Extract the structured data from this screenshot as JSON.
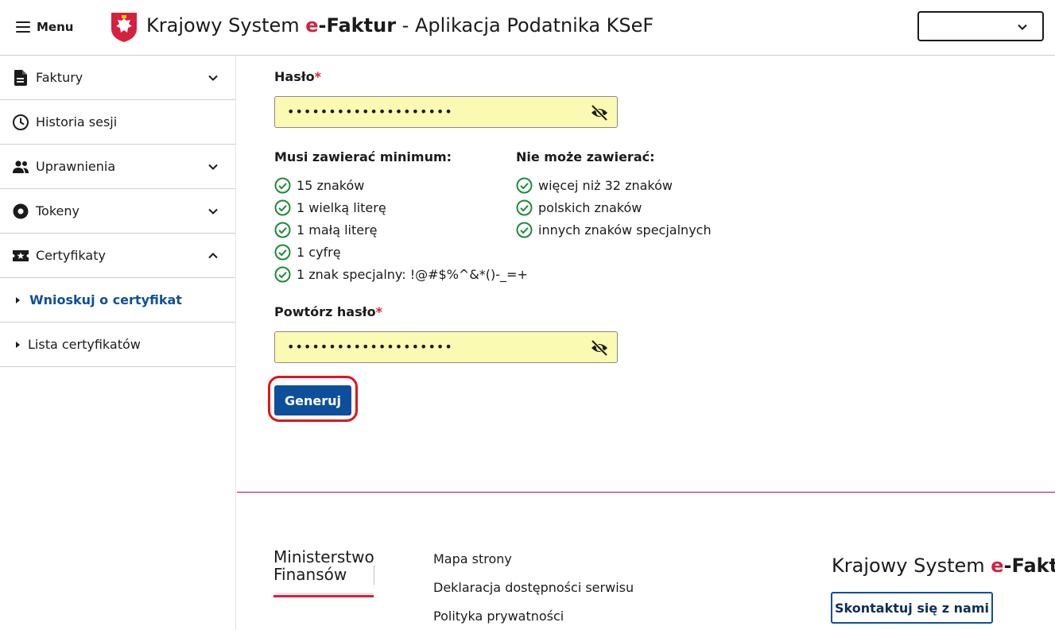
{
  "header": {
    "menu_label": "Menu",
    "brand_prefix": "Krajowy System ",
    "brand_e": "e",
    "brand_faktur": "-Faktur",
    "brand_suffix": " - Aplikacja Podatnika KSeF",
    "language_value": ""
  },
  "sidebar": {
    "items": [
      {
        "label": "Faktury",
        "icon": "document-icon",
        "expandable": true,
        "expanded": false
      },
      {
        "label": "Historia sesji",
        "icon": "clock-icon",
        "expandable": false
      },
      {
        "label": "Uprawnienia",
        "icon": "people-icon",
        "expandable": true,
        "expanded": false
      },
      {
        "label": "Tokeny",
        "icon": "token-icon",
        "expandable": true,
        "expanded": false
      },
      {
        "label": "Certyfikaty",
        "icon": "certificate-icon",
        "expandable": true,
        "expanded": true
      }
    ],
    "subitems": [
      {
        "label": "Wnioskuj o certyfikat",
        "active": true
      },
      {
        "label": "Lista certyfikatów",
        "active": false
      }
    ]
  },
  "form": {
    "password_label": "Hasło",
    "password_value": "••••••••••••••••••••",
    "repeat_label": "Powtórz hasło",
    "repeat_value": "••••••••••••••••••••",
    "required_mark": "*",
    "must_contain_heading": "Musi zawierać minimum:",
    "must_contain": [
      "15 znaków",
      "1 wielką literę",
      "1 małą literę",
      "1 cyfrę",
      "1 znak specjalny: !@#$%^&*()-_=+"
    ],
    "cannot_contain_heading": "Nie może zawierać:",
    "cannot_contain": [
      "więcej niż 32 znaków",
      "polskich znaków",
      "innych znaków specjalnych"
    ],
    "generate_label": "Generuj"
  },
  "footer": {
    "ministry_line1": "Ministerstwo",
    "ministry_line2": "Finansów",
    "links": [
      "Mapa strony",
      "Deklaracja dostępności serwisu",
      "Polityka prywatności"
    ],
    "ksef_prefix": "Krajowy System ",
    "ksef_e": "e",
    "ksef_faktur": "-Faktur",
    "contact_label": "Skontaktuj się z nami"
  },
  "colors": {
    "accent_blue": "#0e4f9c",
    "brand_red": "#d4213d",
    "check_green": "#1f8a3a",
    "input_yellow": "#fafab2",
    "highlight_red": "#e0151b"
  }
}
